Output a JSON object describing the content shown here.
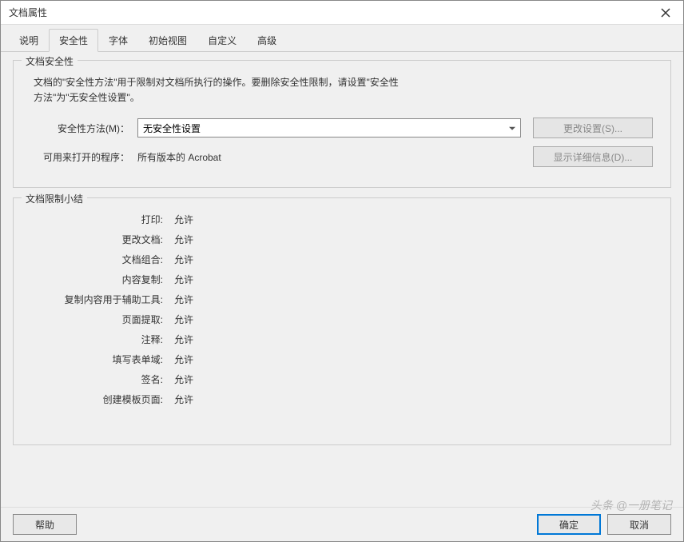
{
  "window": {
    "title": "文档属性"
  },
  "tabs": [
    {
      "label": "说明"
    },
    {
      "label": "安全性"
    },
    {
      "label": "字体"
    },
    {
      "label": "初始视图"
    },
    {
      "label": "自定义"
    },
    {
      "label": "高级"
    }
  ],
  "security_group": {
    "title": "文档安全性",
    "description_line1": "文档的\"安全性方法\"用于限制对文档所执行的操作。要删除安全性限制，请设置\"安全性",
    "description_line2": "方法\"为\"无安全性设置\"。",
    "method_label": "安全性方法(M)：",
    "method_value": "无安全性设置",
    "change_button": "更改设置(S)...",
    "open_program_label": "可用来打开的程序：",
    "open_program_value": "所有版本的 Acrobat",
    "details_button": "显示详细信息(D)..."
  },
  "restrictions_group": {
    "title": "文档限制小结",
    "items": [
      {
        "label": "打印",
        "value": "允许"
      },
      {
        "label": "更改文档",
        "value": "允许"
      },
      {
        "label": "文档组合",
        "value": "允许"
      },
      {
        "label": "内容复制",
        "value": "允许"
      },
      {
        "label": "复制内容用于辅助工具",
        "value": "允许"
      },
      {
        "label": "页面提取",
        "value": "允许"
      },
      {
        "label": "注释",
        "value": "允许"
      },
      {
        "label": "填写表单域",
        "value": "允许"
      },
      {
        "label": "签名",
        "value": "允许"
      },
      {
        "label": "创建模板页面",
        "value": "允许"
      }
    ]
  },
  "footer": {
    "help": "帮助",
    "ok": "确定",
    "cancel": "取消"
  },
  "watermark": "头条 @一册笔记"
}
